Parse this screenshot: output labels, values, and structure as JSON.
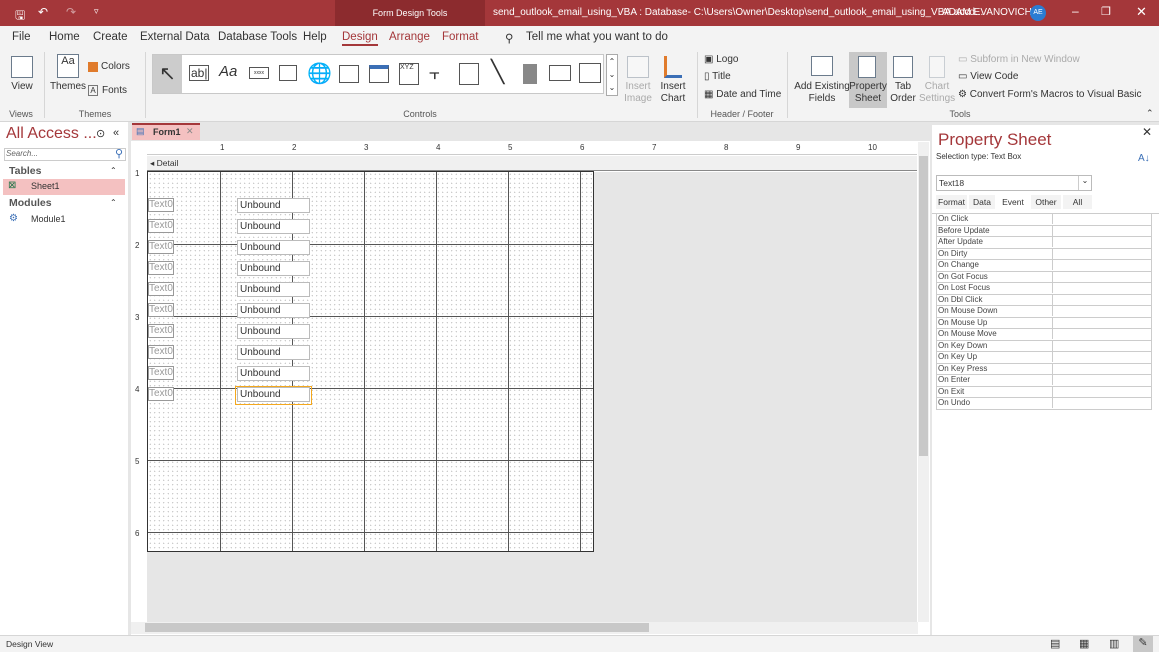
{
  "titlebar": {
    "context": "Form Design Tools",
    "title": "send_outlook_email_using_VBA : Database- C:\\Users\\Owner\\Desktop\\send_outlook_email_using_VBA.accd...",
    "user": "ADAM EVANOVICH",
    "initials": "AE"
  },
  "menu": [
    "File",
    "Home",
    "Create",
    "External Data",
    "Database Tools",
    "Help",
    "Design",
    "Arrange",
    "Format"
  ],
  "tell_me": "Tell me what you want to do",
  "ribbon": {
    "view": "View",
    "views_group": "Views",
    "themes": "Themes",
    "colors": "Colors",
    "fonts": "Fonts",
    "themes_group": "Themes",
    "controls_group": "Controls",
    "insert_image": "Insert Image",
    "insert_chart": "Insert Chart",
    "logo": "Logo",
    "title": "Title",
    "date_time": "Date and Time",
    "header_group": "Header / Footer",
    "add_fields": "Add Existing Fields",
    "property_sheet": "Property Sheet",
    "tab_order": "Tab Order",
    "chart_settings": "Chart Settings",
    "subform": "Subform in New Window",
    "view_code": "View Code",
    "convert": "Convert Form's Macros to Visual Basic",
    "tools_group": "Tools"
  },
  "nav": {
    "title": "All Access ...",
    "search_placeholder": "Search...",
    "tables": "Tables",
    "sheet": "Sheet1",
    "modules": "Modules",
    "module": "Module1"
  },
  "doc": {
    "tab": "Form1",
    "section": "Detail",
    "ruler_h": [
      "1",
      "2",
      "3",
      "4",
      "5",
      "6",
      "7",
      "8",
      "9",
      "10"
    ],
    "ruler_v": [
      "1",
      "2",
      "3",
      "4",
      "5",
      "6"
    ],
    "rows": [
      {
        "label": "Text0",
        "box": "Unbound"
      },
      {
        "label": "Text0",
        "box": "Unbound"
      },
      {
        "label": "Text0",
        "box": "Unbound"
      },
      {
        "label": "Text0",
        "box": "Unbound"
      },
      {
        "label": "Text0",
        "box": "Unbound"
      },
      {
        "label": "Text0",
        "box": "Unbound"
      },
      {
        "label": "Text0",
        "box": "Unbound"
      },
      {
        "label": "Text0",
        "box": "Unbound"
      },
      {
        "label": "Text0",
        "box": "Unbound"
      },
      {
        "label": "Text0",
        "box": "Unbound"
      }
    ]
  },
  "ps": {
    "title": "Property Sheet",
    "selection": "Selection type:  Text Box",
    "object": "Text18",
    "tabs": [
      "Format",
      "Data",
      "Event",
      "Other",
      "All"
    ],
    "props": [
      "On Click",
      "Before Update",
      "After Update",
      "On Dirty",
      "On Change",
      "On Got Focus",
      "On Lost Focus",
      "On Dbl Click",
      "On Mouse Down",
      "On Mouse Up",
      "On Mouse Move",
      "On Key Down",
      "On Key Up",
      "On Key Press",
      "On Enter",
      "On Exit",
      "On Undo"
    ]
  },
  "status": "Design View",
  "colors": {
    "accent": "#a4373a",
    "selection": "#f4a81d"
  }
}
